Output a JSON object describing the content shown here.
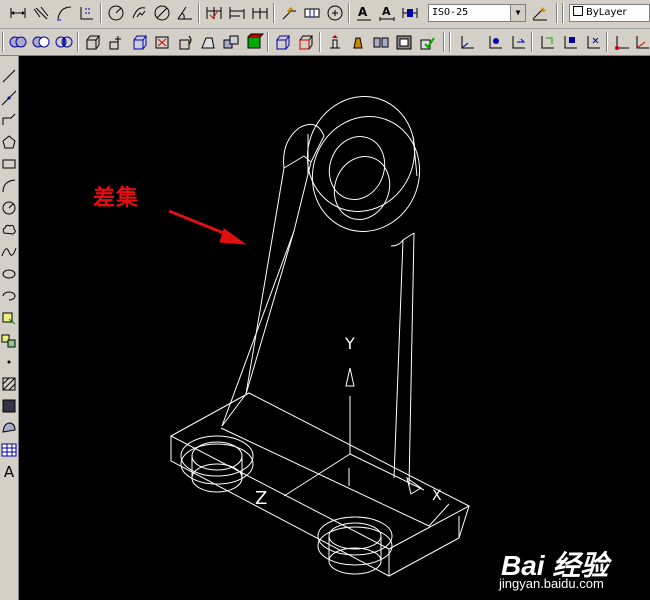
{
  "toolbar_top": {
    "dimstyle_combo_value": "ISO-25",
    "layer_combo_value": "ByLayer"
  },
  "left_toolbar": {
    "text_tool_glyph": "A"
  },
  "canvas": {
    "background": "#000000",
    "annotation_label": "差集",
    "annotation_color": "#e01010",
    "ucs_y_label": "Y",
    "ucs_z_label": "Z",
    "ucs_x_label": "X"
  },
  "watermark": {
    "logo_text": "Bai 经验",
    "url_text": "jingyan.baidu.com"
  }
}
